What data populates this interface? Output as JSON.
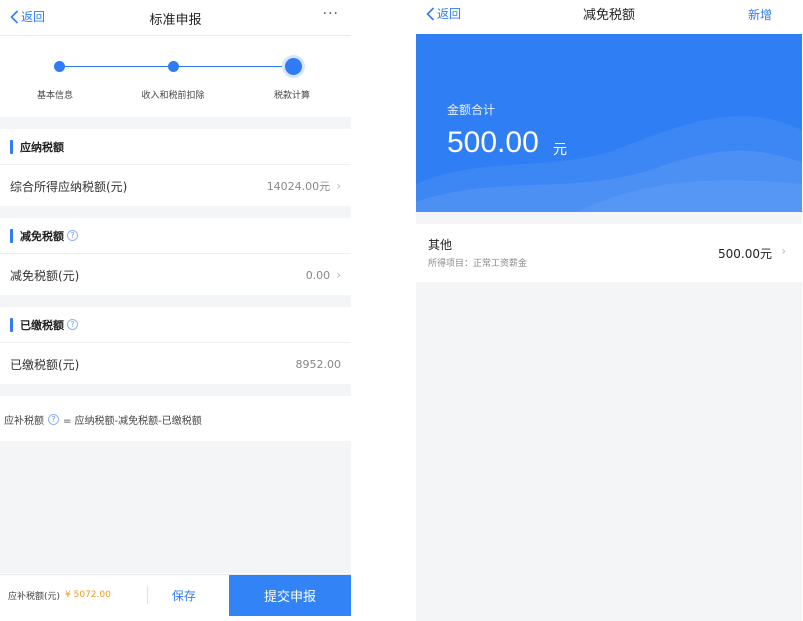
{
  "left": {
    "nav": {
      "back_label": "返回",
      "title": "标准申报",
      "more": "···"
    },
    "steps": [
      {
        "label": "基本信息",
        "status": "done"
      },
      {
        "label": "收入和税前扣除",
        "status": "done"
      },
      {
        "label": "税款计算",
        "status": "current"
      }
    ],
    "sections": [
      {
        "header": "应纳税额",
        "has_help": false,
        "row_label": "综合所得应纳税额(元)",
        "row_value": "14024.00元",
        "has_chevron": true
      },
      {
        "header": "减免税额",
        "has_help": true,
        "row_label": "减免税额(元)",
        "row_value": "0.00",
        "has_chevron": true
      },
      {
        "header": "已缴税额",
        "has_help": true,
        "row_label": "已缴税额(元)",
        "row_value": "8952.00",
        "has_chevron": false
      }
    ],
    "formula": {
      "label": "应补税额",
      "expression": "= 应纳税额-减免税额-已缴税额"
    },
    "bottom": {
      "due_label": "应补税额(元)",
      "due_value": "¥ 5072.00",
      "save_label": "保存",
      "submit_label": "提交申报"
    },
    "colors": {
      "accent": "#2f7cf6",
      "due": "#f39a1e"
    }
  },
  "right": {
    "nav": {
      "back_label": "返回",
      "title": "减免税额",
      "add_label": "新增"
    },
    "banner": {
      "label": "金额合计",
      "amount": "500.00",
      "unit": "元"
    },
    "item": {
      "title": "其他",
      "subtitle": "所得项目：正常工资薪金",
      "value": "500.00元"
    },
    "colors": {
      "banner": "#2f7ef4"
    }
  }
}
